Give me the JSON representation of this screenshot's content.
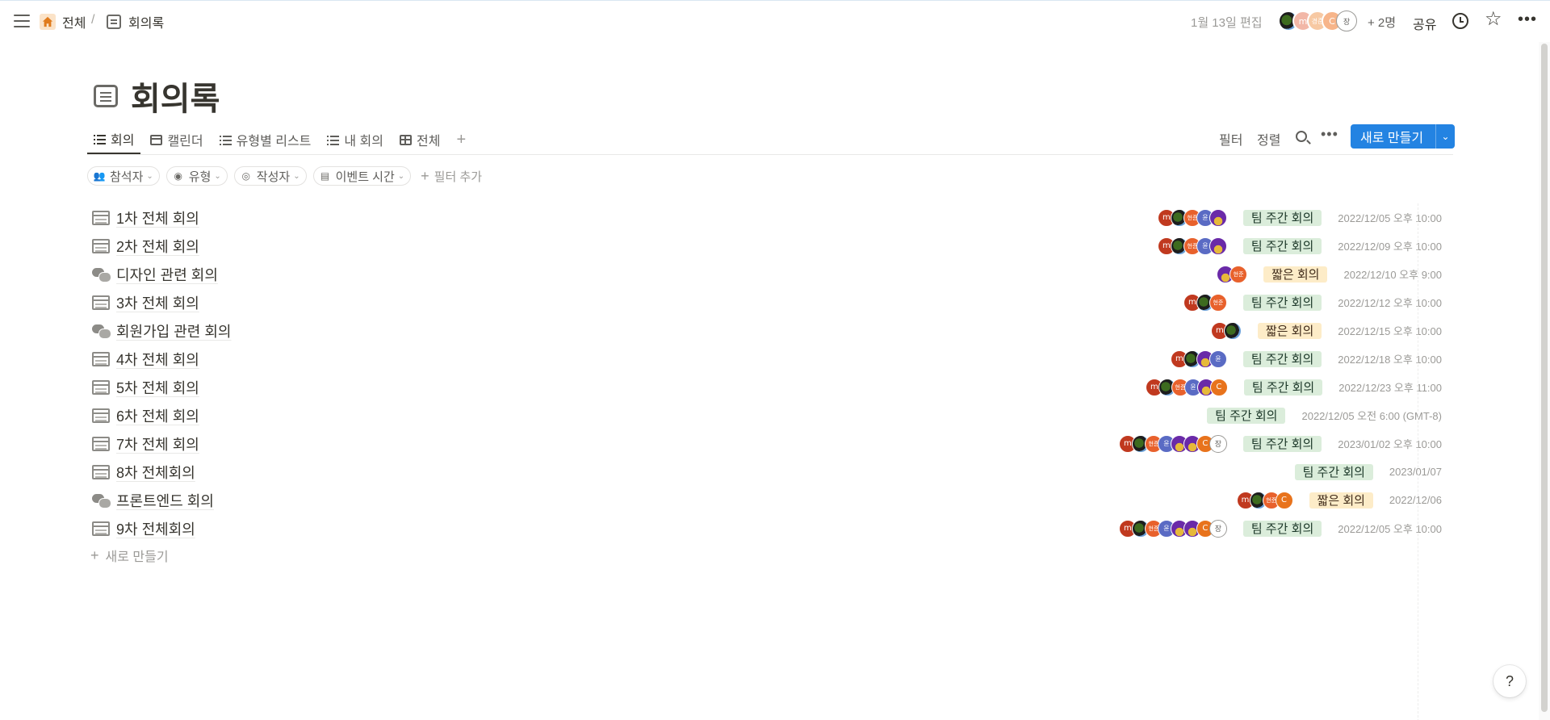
{
  "breadcrumb": {
    "home": "전체",
    "sep": "/",
    "page": "회의록"
  },
  "topbar": {
    "edited": "1월 13일 편집",
    "more_people": "+ 2명",
    "share": "공유",
    "avatars": [
      "bird",
      "m",
      "경준",
      "C",
      "장"
    ]
  },
  "page": {
    "title": "회의록"
  },
  "views": [
    {
      "label": "회의",
      "icon": "list-icon",
      "active": true
    },
    {
      "label": "캘린더",
      "icon": "calendar-icon"
    },
    {
      "label": "유형별 리스트",
      "icon": "list-icon"
    },
    {
      "label": "내 회의",
      "icon": "list-icon"
    },
    {
      "label": "전체",
      "icon": "table-icon"
    }
  ],
  "actions": {
    "filter": "필터",
    "sort": "정렬",
    "new": "새로 만들기",
    "add_view": "+"
  },
  "filters": [
    {
      "label": "참석자",
      "icon": "people-icon"
    },
    {
      "label": "유형",
      "icon": "tag-icon"
    },
    {
      "label": "작성자",
      "icon": "person-icon"
    },
    {
      "label": "이벤트 시간",
      "icon": "calendar-icon"
    }
  ],
  "add_filter": "필터 추가",
  "rows": [
    {
      "title": "1차 전체 회의",
      "icon": "calendar",
      "avatars": [
        "m",
        "bird",
        "hj",
        "yun",
        "pur"
      ],
      "tag": "팀 주간 회의",
      "tag_color": "green",
      "date": "2022/12/05 오후 10:00"
    },
    {
      "title": "2차 전체 회의",
      "icon": "calendar",
      "avatars": [
        "m",
        "bird",
        "hj",
        "yun",
        "pur"
      ],
      "tag": "팀 주간 회의",
      "tag_color": "green",
      "date": "2022/12/09 오후 10:00"
    },
    {
      "title": "디자인 관련 회의",
      "icon": "chat",
      "avatars": [
        "pur",
        "hj"
      ],
      "tag": "짧은 회의",
      "tag_color": "yellow",
      "date": "2022/12/10 오후 9:00"
    },
    {
      "title": "3차 전체 회의",
      "icon": "calendar",
      "avatars": [
        "m",
        "bird",
        "hj"
      ],
      "tag": "팀 주간 회의",
      "tag_color": "green",
      "date": "2022/12/12 오후 10:00"
    },
    {
      "title": "회원가입 관련 회의",
      "icon": "chat",
      "avatars": [
        "m",
        "bird"
      ],
      "tag": "짧은 회의",
      "tag_color": "yellow",
      "date": "2022/12/15 오후 10:00"
    },
    {
      "title": "4차 전체 회의",
      "icon": "calendar",
      "avatars": [
        "m",
        "bird",
        "pur",
        "yun"
      ],
      "tag": "팀 주간 회의",
      "tag_color": "green",
      "date": "2022/12/18 오후 10:00"
    },
    {
      "title": "5차 전체 회의",
      "icon": "calendar",
      "avatars": [
        "m",
        "bird",
        "hj",
        "yun",
        "pur",
        "c"
      ],
      "tag": "팀 주간 회의",
      "tag_color": "green",
      "date": "2022/12/23 오후 11:00"
    },
    {
      "title": "6차 전체 회의",
      "icon": "calendar",
      "avatars": [],
      "tag": "팀 주간 회의",
      "tag_color": "green",
      "date": "2022/12/05 오전 6:00 (GMT-8)"
    },
    {
      "title": "7차 전체 회의",
      "icon": "calendar",
      "avatars": [
        "m",
        "bird",
        "hj",
        "yun",
        "pur",
        "pur",
        "c",
        "jang"
      ],
      "tag": "팀 주간 회의",
      "tag_color": "green",
      "date": "2023/01/02 오후 10:00"
    },
    {
      "title": "8차 전체회의",
      "icon": "calendar",
      "avatars": [],
      "tag": "팀 주간 회의",
      "tag_color": "green",
      "date": "2023/01/07"
    },
    {
      "title": "프론트엔드 회의",
      "icon": "chat",
      "avatars": [
        "m",
        "bird",
        "hj",
        "c"
      ],
      "tag": "짧은 회의",
      "tag_color": "yellow",
      "date": "2022/12/06"
    },
    {
      "title": "9차 전체회의",
      "icon": "calendar",
      "avatars": [
        "m",
        "bird",
        "hj",
        "yun",
        "pur",
        "pur",
        "c",
        "jang"
      ],
      "tag": "팀 주간 회의",
      "tag_color": "green",
      "date": "2022/12/05 오후 10:00"
    }
  ],
  "avatar_text": {
    "m": "m",
    "hj": "현준",
    "yun": "윤",
    "c": "C",
    "jang": "장",
    "bird": "",
    "pur": ""
  },
  "new_row": "새로 만들기",
  "help": "?"
}
